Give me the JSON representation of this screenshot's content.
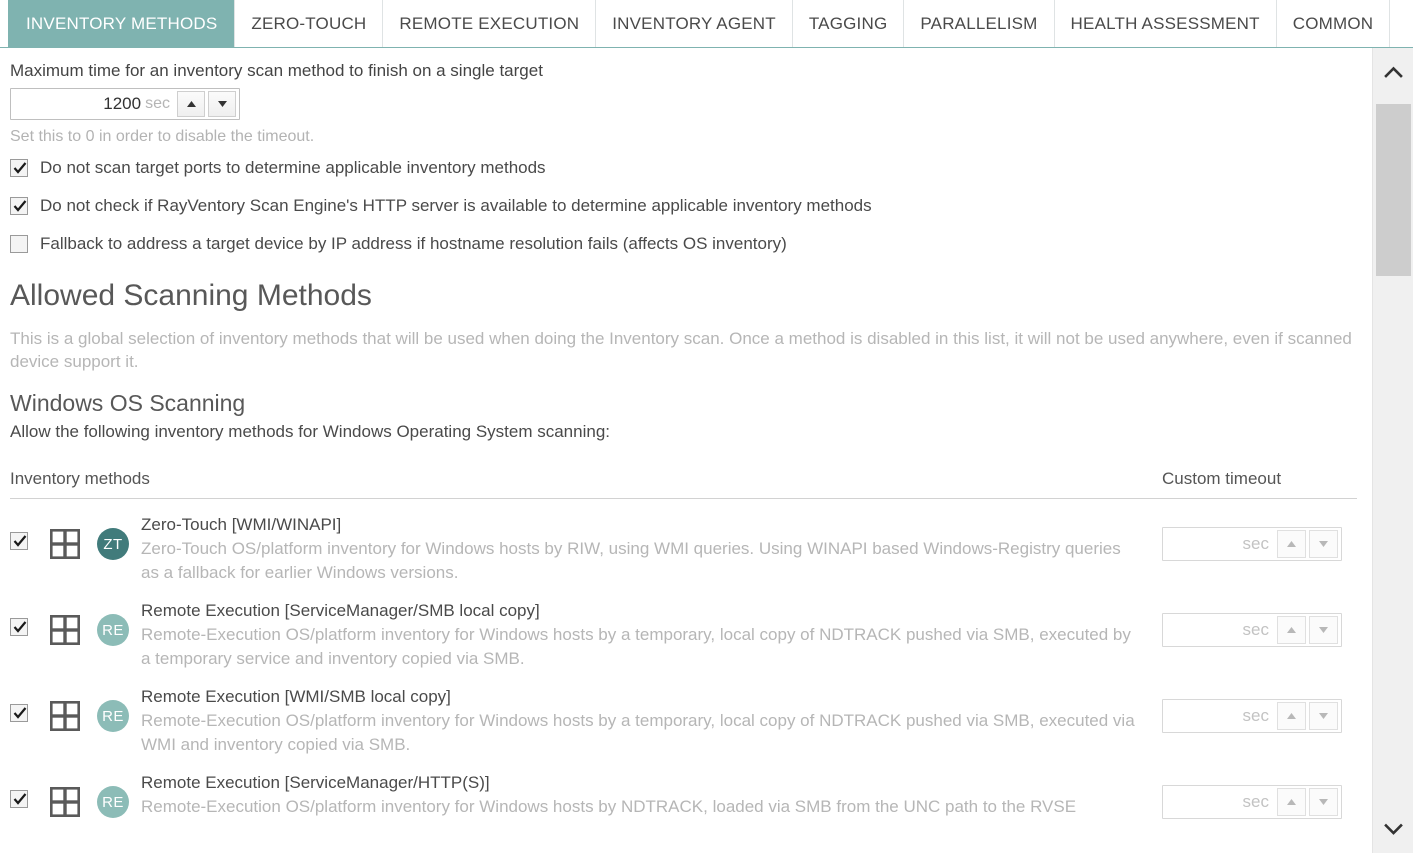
{
  "tabs": [
    {
      "label": "INVENTORY METHODS",
      "active": true
    },
    {
      "label": "ZERO-TOUCH",
      "active": false
    },
    {
      "label": "REMOTE EXECUTION",
      "active": false
    },
    {
      "label": "INVENTORY AGENT",
      "active": false
    },
    {
      "label": "TAGGING",
      "active": false
    },
    {
      "label": "PARALLELISM",
      "active": false
    },
    {
      "label": "HEALTH ASSESSMENT",
      "active": false
    },
    {
      "label": "COMMON",
      "active": false
    }
  ],
  "timeout": {
    "label": "Maximum time for an inventory scan method to finish on a single target",
    "value": "1200",
    "unit": "sec",
    "hint": "Set this to 0 in order to disable the timeout."
  },
  "options": [
    {
      "label": "Do not scan target ports to determine applicable inventory methods",
      "checked": true
    },
    {
      "label": "Do not check if RayVentory Scan Engine's HTTP server is available to determine applicable inventory methods",
      "checked": true
    },
    {
      "label": "Fallback to address a target device by IP address if hostname resolution fails (affects OS inventory)",
      "checked": false
    }
  ],
  "allowed": {
    "heading": "Allowed Scanning Methods",
    "description": "This is a global selection of inventory methods that will be used when doing the Inventory scan. Once a method is disabled in this list, it will not be used anywhere, even if scanned device support it.",
    "subheading": "Windows OS Scanning",
    "subdescription": "Allow the following inventory methods for Windows Operating System scanning:"
  },
  "table": {
    "col_methods": "Inventory methods",
    "col_timeout": "Custom timeout",
    "timeout_unit": "sec",
    "rows": [
      {
        "checked": true,
        "platform_icon": "windows-grid-icon",
        "badge": "ZT",
        "badge_color": "#417b7b",
        "title": "Zero-Touch [WMI/WINAPI]",
        "description": "Zero-Touch OS/platform inventory for Windows hosts by RIW, using WMI queries. Using WINAPI based Windows-Registry queries as a fallback for earlier Windows versions.",
        "timeout_value": ""
      },
      {
        "checked": true,
        "platform_icon": "windows-grid-icon",
        "badge": "RE",
        "badge_color": "#8cbcb7",
        "title": "Remote Execution [ServiceManager/SMB local copy]",
        "description": "Remote-Execution OS/platform inventory for Windows hosts by a temporary, local copy of NDTRACK pushed via SMB, executed by a temporary service and inventory copied via SMB.",
        "timeout_value": ""
      },
      {
        "checked": true,
        "platform_icon": "windows-grid-icon",
        "badge": "RE",
        "badge_color": "#8cbcb7",
        "title": "Remote Execution [WMI/SMB local copy]",
        "description": "Remote-Execution OS/platform inventory for Windows hosts by a temporary, local copy of NDTRACK pushed via SMB, executed via WMI and inventory copied via SMB.",
        "timeout_value": ""
      },
      {
        "checked": true,
        "platform_icon": "windows-grid-icon",
        "badge": "RE",
        "badge_color": "#8cbcb7",
        "title": "Remote Execution [ServiceManager/HTTP(S)]",
        "description": "Remote-Execution OS/platform inventory for Windows hosts by NDTRACK, loaded via SMB from the UNC path to the RVSE",
        "timeout_value": ""
      }
    ]
  },
  "scrollbar": {
    "up_icon": "chevron-up-icon",
    "down_icon": "chevron-down-icon"
  },
  "colors": {
    "accent": "#7fb3b0",
    "text": "#4a4a4a",
    "muted": "#b6b6b6"
  }
}
